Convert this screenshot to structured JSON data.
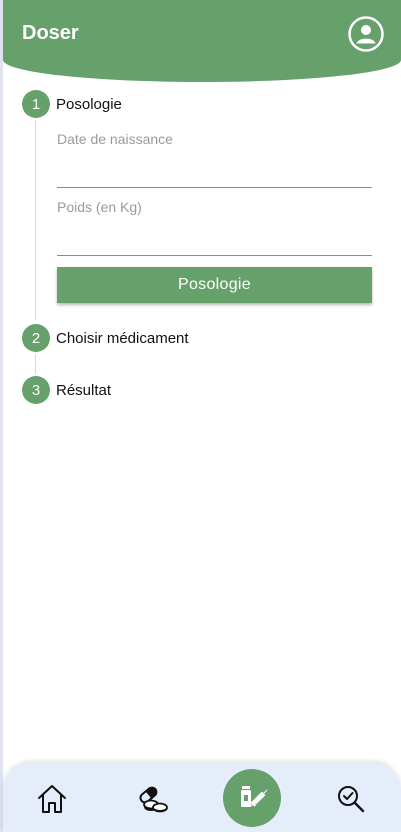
{
  "header": {
    "title": "Doser",
    "accent_color": "#66a06b",
    "profile_icon": "user-circle-icon"
  },
  "stepper": {
    "steps": [
      {
        "number": "1",
        "label": "Posologie"
      },
      {
        "number": "2",
        "label": "Choisir médicament"
      },
      {
        "number": "3",
        "label": "Résultat"
      }
    ]
  },
  "form": {
    "birthdate": {
      "label": "Date de naissance",
      "value": ""
    },
    "weight": {
      "label": "Poids (en Kg)",
      "value": ""
    },
    "submit_label": "Posologie"
  },
  "bottom_nav": {
    "items": [
      {
        "name": "home",
        "icon": "home-icon"
      },
      {
        "name": "medications",
        "icon": "pills-icon"
      },
      {
        "name": "dose",
        "icon": "dose-bottle-syringe-icon",
        "active": true
      },
      {
        "name": "search",
        "icon": "search-check-icon"
      }
    ],
    "background": "#e6edfa"
  }
}
